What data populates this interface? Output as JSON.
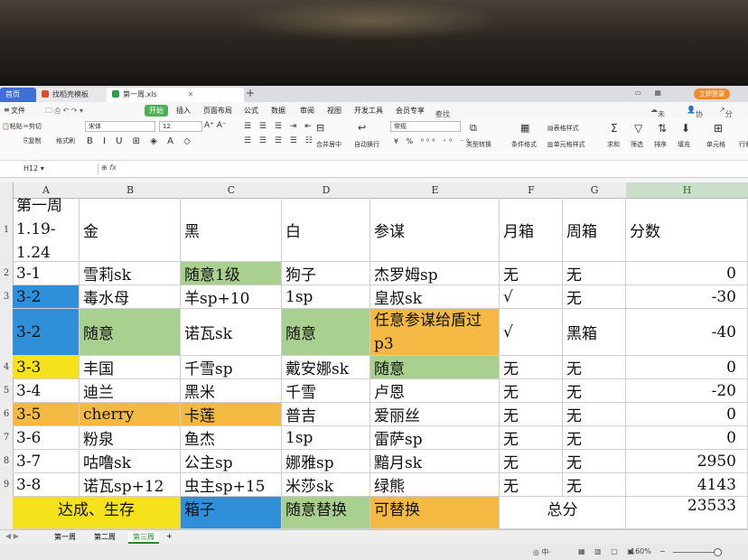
{
  "tabs": {
    "home": "首页",
    "template": "找稻壳模板",
    "file": "第一周.xls",
    "new_tab": "+"
  },
  "account": "立即登录",
  "menu": {
    "file": "文件",
    "start": "开始",
    "insert": "插入",
    "page_layout": "页面布局",
    "formula": "公式",
    "data": "数据",
    "review": "审阅",
    "view": "视图",
    "dev": "开发工具",
    "member": "会员专享",
    "search": "查找命令、搜索模板",
    "unsynced": "未同步",
    "collab": "协作",
    "share": "分享"
  },
  "ribbon": {
    "cut": "剪切",
    "copy": "复制",
    "paste": "粘贴",
    "format_painter": "格式刷",
    "font_name": "宋体",
    "font_size": "12",
    "merge_center": "合并居中",
    "auto_wrap": "自动换行",
    "number_format": "常规",
    "type_convert": "类型转换",
    "cond_format": "条件格式",
    "table_style": "表格样式",
    "cell_style": "单元格样式",
    "sum": "求和",
    "filter": "筛选",
    "sort": "排序",
    "fill": "填充",
    "cell": "单元格",
    "row_col": "行和列"
  },
  "formula_bar": {
    "name_box": "H12",
    "fx": "fx"
  },
  "columns": [
    "A",
    "B",
    "C",
    "D",
    "E",
    "F",
    "G",
    "H"
  ],
  "row_numbers": [
    "1",
    "2",
    "3",
    "",
    "4",
    "5",
    "6",
    "7",
    "8",
    "9"
  ],
  "rows": [
    [
      "第一周 1.19-1.24",
      "金",
      "黑",
      "白",
      "参谋",
      "月箱",
      "周箱",
      "分数"
    ],
    [
      "3-1",
      "雪莉sk",
      "随意1级",
      "狗子",
      "杰罗姆sp",
      "无",
      "无",
      "0"
    ],
    [
      "3-2",
      "毒水母",
      "羊sp+10",
      "1sp",
      "皇叔sk",
      "√",
      "无",
      "-30"
    ],
    [
      "3-2",
      "随意",
      "诺瓦sk",
      "随意",
      "任意参谋给盾过p3",
      "√",
      "黑箱",
      "-40"
    ],
    [
      "3-3",
      "丰国",
      "千雪sp",
      "戴安娜sk",
      "随意",
      "无",
      "无",
      "0"
    ],
    [
      "3-4",
      "迪兰",
      "黑米",
      "千雪",
      "卢恩",
      "无",
      "无",
      "-20"
    ],
    [
      "3-5",
      "cherry",
      "卡莲",
      "普吉",
      "爱丽丝",
      "无",
      "无",
      "0"
    ],
    [
      "3-6",
      "粉泉",
      "鱼杰",
      "1sp",
      "雷萨sp",
      "无",
      "无",
      "0"
    ],
    [
      "3-7",
      "咕噜sk",
      "公主sp",
      "娜雅sp",
      "黯月sk",
      "无",
      "无",
      "2950"
    ],
    [
      "3-8",
      "诺瓦sp+12",
      "虫主sp+15",
      "米莎sk",
      "绿熊",
      "无",
      "无",
      "4143"
    ]
  ],
  "legend_row": {
    "a": "达成、生存",
    "c": "箱子",
    "d": "随意替换",
    "e": "可替换",
    "total_label": "总分",
    "total_value": "23533"
  },
  "sheet_tabs": [
    "第一周",
    "第二周",
    "第三周"
  ],
  "status": {
    "zoom": "160%"
  },
  "colors": {
    "green": "#a9d08e",
    "blue": "#2f8fd8",
    "yellow": "#f5e21b",
    "orange": "#f4b942"
  }
}
